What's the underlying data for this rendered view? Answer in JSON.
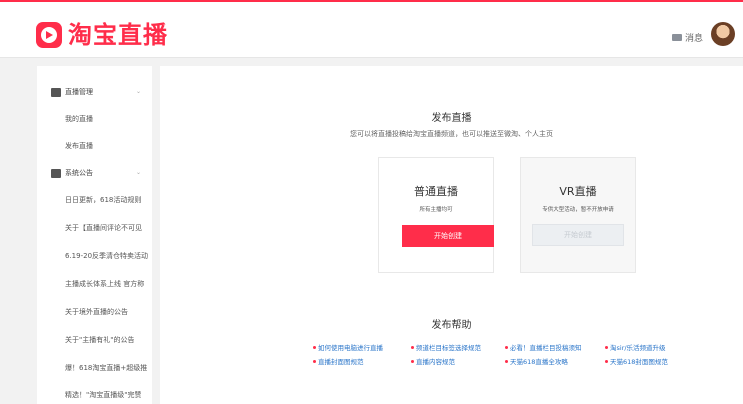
{
  "header": {
    "logo_text": "淘宝直播",
    "messages_label": "消息"
  },
  "sidebar": {
    "groups": [
      {
        "label": "直播管理",
        "items": [
          "我的直播",
          "发布直播"
        ]
      },
      {
        "label": "系统公告",
        "items": [
          "日日更新，618活动规则",
          "关于【直播间评论不可见",
          "6.19-20反季清仓特卖活动",
          "主播成长体系上线 官方称",
          "关于境外直播的公告",
          "关于\"主播有礼\"的公告",
          "爆！618淘宝直播+超级推",
          "精选！\"淘宝直播级\"完赞"
        ]
      }
    ]
  },
  "main": {
    "title": "发布直播",
    "subtitle": "您可以将直播投稿给淘宝直播频道，也可以推送至微淘、个人主页",
    "cards": [
      {
        "title": "普通直播",
        "desc": "所有主播均可",
        "button": "开始创建"
      },
      {
        "title": "VR直播",
        "desc": "专供大型活动，暂不开放申请",
        "button": "开始创建"
      }
    ],
    "help": {
      "title": "发布帮助",
      "links": [
        "如何使用电脑进行直播",
        "频道栏目标签选择规范",
        "必看！直播栏目投稿须知",
        "淘sir/乐活频道升级",
        "直播封面图规范",
        "直播内容规范",
        "天猫618直播全攻略",
        "天猫618封面图规范"
      ]
    }
  },
  "colors": {
    "brand": "#ff2d4a",
    "link": "#2a75c9"
  }
}
